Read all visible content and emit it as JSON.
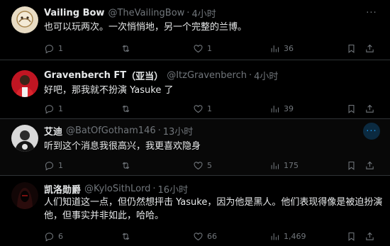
{
  "tweets": [
    {
      "name": "Vailing Bow",
      "name_badge": "",
      "handle": "@TheVailingBow",
      "time": "4小时",
      "text": "也可以玩两次。一次悄悄地，另一个完整的兰博。",
      "replies": "1",
      "retweets": "",
      "likes": "1",
      "views": "36"
    },
    {
      "name": "Gravenberch FT",
      "name_badge": "（亚当）",
      "handle": "@ItzGravenberch",
      "time": "4小时",
      "text": "好吧，那我就不扮演 Yasuke 了",
      "replies": "1",
      "retweets": "",
      "likes": "1",
      "views": "39"
    },
    {
      "name": "艾迪",
      "name_badge": "",
      "handle": "@BatOfGotham146",
      "time": "13小时",
      "text": "听到这个消息我很高兴，我更喜欢隐身",
      "replies": "1",
      "retweets": "",
      "likes": "5",
      "views": "175"
    },
    {
      "name": "凯洛勋爵",
      "name_badge": "",
      "handle": "@KyloSithLord",
      "time": "16小时",
      "text": "人们知道这一点，但仍然想抨击 Yasuke，因为他是黑人。他们表现得像是被迫扮演他，但事实并非如此，哈哈。",
      "replies": "6",
      "retweets": "",
      "likes": "66",
      "views": "1,469"
    }
  ],
  "separator": "·",
  "more_glyph": "···",
  "icons": [
    "reply-icon",
    "retweet-icon",
    "like-icon",
    "views-icon",
    "bookmark-icon",
    "share-icon"
  ],
  "colors": {
    "background": "#000000",
    "text": "#e7e9ea",
    "muted": "#71767b",
    "accent": "#1d9bf0",
    "border": "#2f3336"
  }
}
